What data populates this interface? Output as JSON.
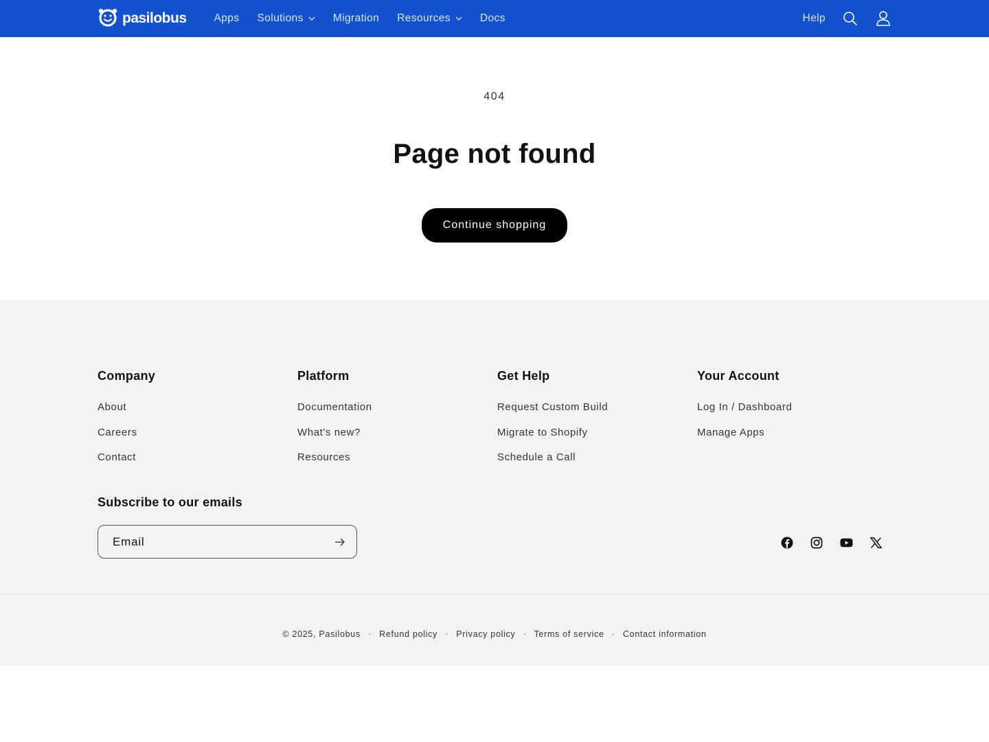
{
  "header": {
    "logo_text": "pasilobus",
    "nav": [
      {
        "label": "Apps",
        "dropdown": false
      },
      {
        "label": "Solutions",
        "dropdown": true
      },
      {
        "label": "Migration",
        "dropdown": false
      },
      {
        "label": "Resources",
        "dropdown": true
      },
      {
        "label": "Docs",
        "dropdown": false
      }
    ],
    "help_label": "Help",
    "icons": {
      "search": "search-icon",
      "account": "account-icon"
    },
    "brand_color": "#1352cf"
  },
  "main": {
    "code": "404",
    "title": "Page not found",
    "cta_label": "Continue shopping"
  },
  "footer": {
    "columns": [
      {
        "heading": "Company",
        "links": [
          "About",
          "Careers",
          "Contact"
        ]
      },
      {
        "heading": "Platform",
        "links": [
          "Documentation",
          "What's new?",
          "Resources"
        ]
      },
      {
        "heading": "Get Help",
        "links": [
          "Request Custom Build",
          "Migrate to Shopify",
          "Schedule a Call"
        ]
      },
      {
        "heading": "Your Account",
        "links": [
          "Log In / Dashboard",
          "Manage Apps"
        ]
      }
    ],
    "subscribe": {
      "heading": "Subscribe to our emails",
      "placeholder": "Email"
    },
    "socials": [
      "facebook-icon",
      "instagram-icon",
      "youtube-icon",
      "x-icon"
    ],
    "bottom": {
      "copyright": "© 2025, Pasilobus",
      "links": [
        "Refund policy",
        "Privacy policy",
        "Terms of service",
        "Contact information"
      ],
      "separator": "·"
    },
    "background_color": "#f3f3f3"
  }
}
